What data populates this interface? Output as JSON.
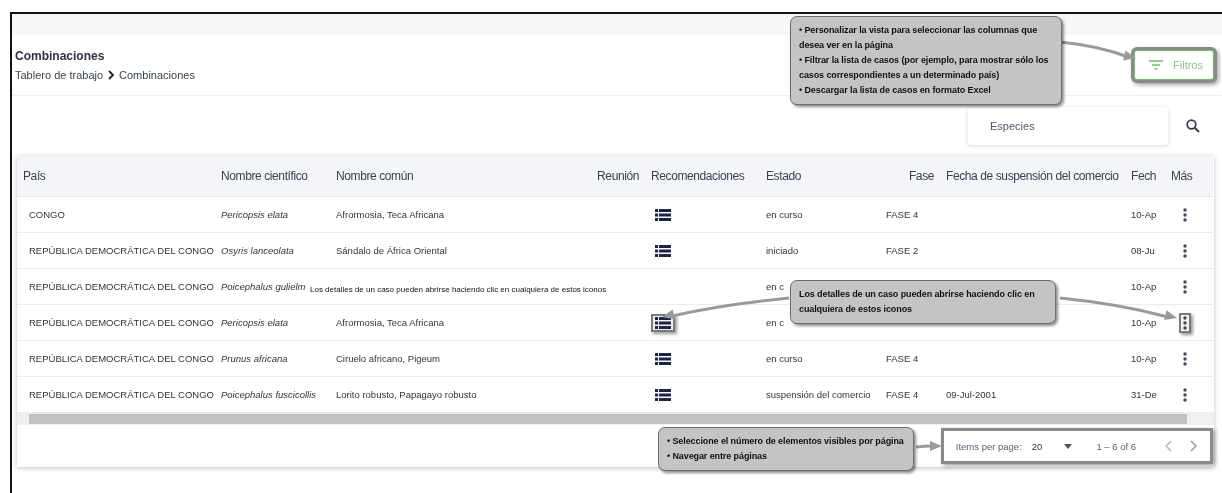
{
  "page": {
    "title": "Combinaciones",
    "breadcrumb": [
      "Tablero de trabajo",
      "Combinaciones"
    ]
  },
  "filter_button": {
    "label": "Filtros",
    "highlighted": true
  },
  "search": {
    "placeholder": "Especies"
  },
  "table": {
    "columns": [
      "País",
      "Nombre científico",
      "Nombre común",
      "Reunión",
      "Recomendaciones",
      "Estado",
      "Fase",
      "Fecha de suspensión del comercio",
      "Fech",
      "Más"
    ],
    "rows": [
      {
        "country": "CONGO",
        "scientific": "Pericopsis elata",
        "common": "Afrormosia, Teca Africana",
        "details_icon": true,
        "highlighted": false,
        "status": "en curso",
        "phase": "FASE 4",
        "suspension": "",
        "date": "10-Ap"
      },
      {
        "country": "REPÚBLICA DEMOCRÁTICA DEL CONGO",
        "scientific": "Osyris lanceolata",
        "common": "Sándalo de África Oriental",
        "details_icon": true,
        "highlighted": false,
        "status": "iniciado",
        "phase": "FASE 2",
        "suspension": "",
        "date": "08-Ju"
      },
      {
        "country": "REPÚBLICA DEMOCRÁTICA DEL CONGO",
        "scientific": "Poicephalus gulielm",
        "common": "",
        "details_icon": false,
        "highlighted": false,
        "status": "en c",
        "phase": "",
        "suspension": "",
        "date": "10-Ap"
      },
      {
        "country": "REPÚBLICA DEMOCRÁTICA DEL CONGO",
        "scientific": "Pericopsis elata",
        "common": "Afrormosia, Teca Africana",
        "details_icon": true,
        "highlighted": true,
        "status": "en c",
        "phase": "",
        "suspension": "",
        "date": "10-Ap"
      },
      {
        "country": "REPÚBLICA DEMOCRÁTICA DEL CONGO",
        "scientific": "Prunus africana",
        "common": "Ciruelo africano, Pigeum",
        "details_icon": true,
        "highlighted": false,
        "status": "en curso",
        "phase": "FASE 4",
        "suspension": "",
        "date": "10-Ap"
      },
      {
        "country": "REPÚBLICA DEMOCRÁTICA DEL CONGO",
        "scientific": "Poicephalus fuscicollis",
        "common": "Lorito robusto, Papagayo robusto",
        "details_icon": true,
        "highlighted": false,
        "status": "suspensión del comercio",
        "phase": "FASE 4",
        "suspension": "09-Jul-2001",
        "date": "31-De"
      }
    ]
  },
  "stray_caption": "Los detalles de un caso pueden abrirse haciendo clic en cualquiera de estos iconos",
  "paginator": {
    "label": "Items per page:",
    "page_size": "20",
    "range": "1 – 6 of 6",
    "highlighted": true
  },
  "callouts": [
    {
      "lines": [
        "• Personalizar la vista para seleccionar las columnas que desea ver en la página",
        "• Filtrar la lista de casos (por ejemplo, para mostrar sólo los casos correspondientes a un determinado país)",
        "• Descargar la lista de casos en formato Excel"
      ]
    },
    {
      "lines": [
        "Los detalles de un caso pueden abrirse haciendo clic en cualquiera de estos iconos"
      ]
    },
    {
      "lines": [
        "• Seleccione el número de elementos visibles por página",
        "• Navegar entre páginas"
      ]
    }
  ]
}
